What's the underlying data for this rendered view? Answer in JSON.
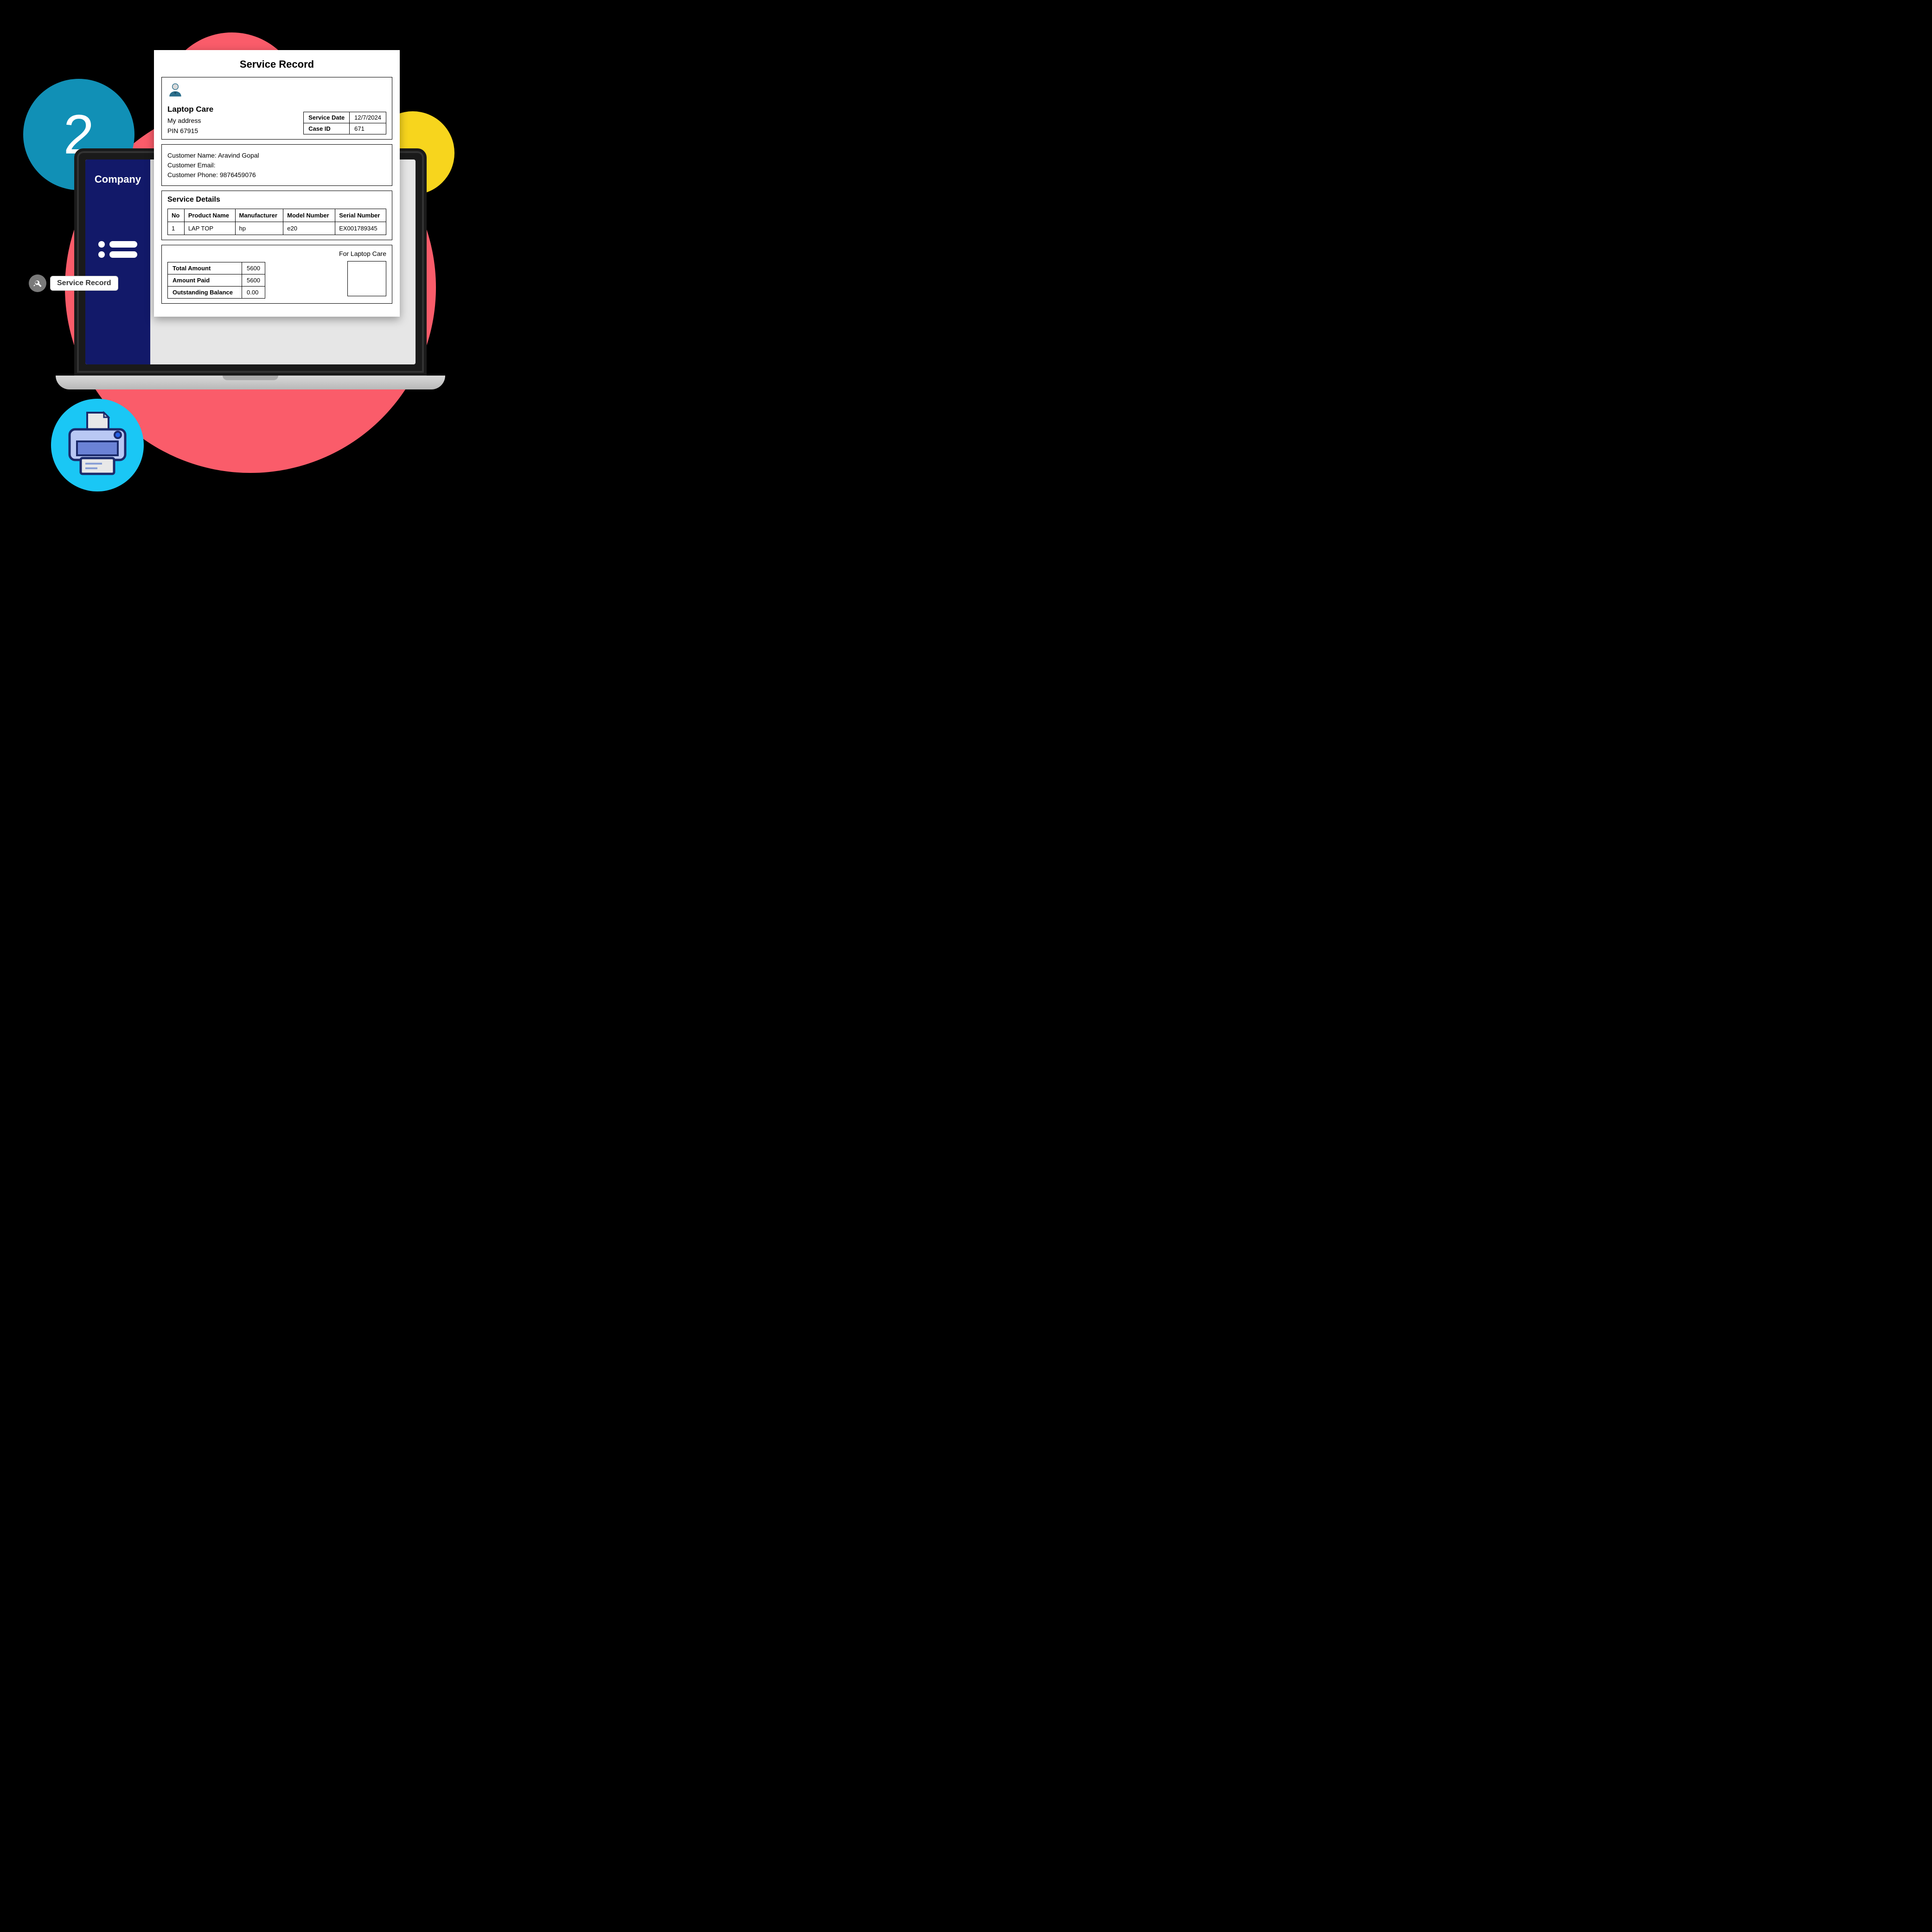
{
  "decor": {
    "step_number": "2"
  },
  "sidebar": {
    "title": "Company"
  },
  "tag": {
    "label": "Service Record"
  },
  "doc": {
    "title": "Service Record",
    "company": {
      "name": "Laptop Care",
      "address": "My address",
      "pin": "PIN 67915"
    },
    "meta": {
      "service_date_label": "Service Date",
      "service_date": "12/7/2024",
      "case_id_label": "Case ID",
      "case_id": "671"
    },
    "customer": {
      "name_label": "Customer Name:",
      "name": "Aravind Gopal",
      "email_label": "Customer Email:",
      "email": "",
      "phone_label": "Customer Phone:",
      "phone": "9876459076"
    },
    "details": {
      "heading": "Service Details",
      "headers": {
        "no": "No",
        "product": "Product Name",
        "manufacturer": "Manufacturer",
        "model": "Model Number",
        "serial": "Serial Number"
      },
      "rows": [
        {
          "no": "1",
          "product": "LAP TOP",
          "manufacturer": "hp",
          "model": "e20",
          "serial": "EX001789345"
        }
      ]
    },
    "amounts": {
      "total_label": "Total Amount",
      "total": "5600",
      "paid_label": "Amount Paid",
      "paid": "5600",
      "balance_label": "Outstanding Balance",
      "balance": "0.00"
    },
    "signature": {
      "for_label": "For Laptop Care"
    }
  }
}
